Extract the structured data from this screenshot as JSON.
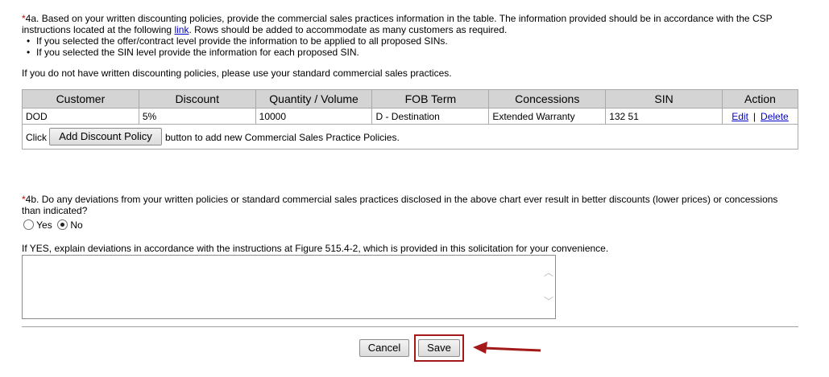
{
  "q4a": {
    "required_mark": "*",
    "text_before_link": "4a. Based on your written discounting policies, provide the commercial sales practices information in the table.  The information provided should be in accordance with the CSP instructions located at the following ",
    "link_text": "link",
    "text_after_link": ".  Rows should be added to accommodate as many customers as required.",
    "bullets": [
      "If you selected the offer/contract level provide the information to be applied to all proposed SINs.",
      "If you selected the SIN level provide the information for each proposed SIN."
    ],
    "no_policy_note": "If you do not have written discounting policies, please use your standard commercial sales practices."
  },
  "table": {
    "headers": [
      "Customer",
      "Discount",
      "Quantity / Volume",
      "FOB Term",
      "Concessions",
      "SIN",
      "Action"
    ],
    "rows": [
      {
        "customer": "DOD",
        "discount": "5%",
        "quantity": "10000",
        "fob": "D - Destination",
        "concessions": "Extended Warranty",
        "sin": "132 51",
        "edit": "Edit",
        "separator": "|",
        "delete": "Delete"
      }
    ],
    "add_prefix": "Click",
    "add_button": "Add Discount Policy",
    "add_suffix": "button to add new Commercial Sales Practice Policies."
  },
  "q4b": {
    "required_mark": "*",
    "text": "4b. Do any deviations from your written policies or standard commercial sales practices disclosed in the above chart ever result in better discounts (lower prices) or concessions than indicated?",
    "yes_label": "Yes",
    "no_label": "No",
    "selected": "No",
    "explain_label": "If YES, explain deviations in accordance with the instructions at Figure 515.4-2, which is provided in this solicitation for your convenience.",
    "explain_value": ""
  },
  "footer": {
    "cancel_label": "Cancel",
    "save_label": "Save",
    "highlight_color": "#a31818"
  }
}
